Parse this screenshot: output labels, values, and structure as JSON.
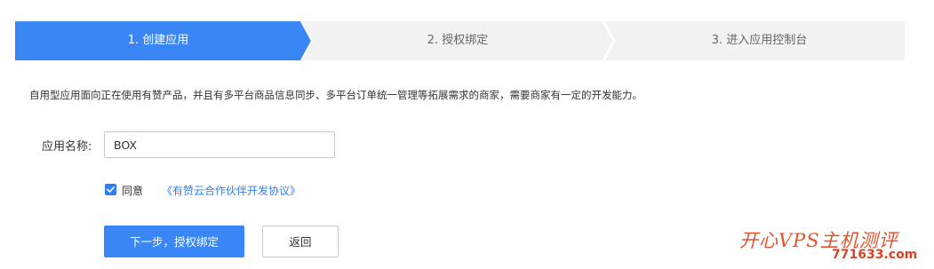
{
  "steps": [
    {
      "label": "1. 创建应用",
      "active": true
    },
    {
      "label": "2. 授权绑定",
      "active": false
    },
    {
      "label": "3. 进入应用控制台",
      "active": false
    }
  ],
  "description": "自用型应用面向正在使用有赞产品，并且有多平台商品信息同步、多平台订单统一管理等拓展需求的商家，需要商家有一定的开发能力。",
  "form": {
    "name_label": "应用名称:",
    "name_value": "BOX",
    "agree_checked": true,
    "agree_label": "同意",
    "agreement_link": "《有赞云合作伙伴开发协议》"
  },
  "buttons": {
    "next_label": "下一步，授权绑定",
    "back_label": "返回"
  },
  "watermark": {
    "title": "开心VPS主机测评",
    "url": "771633.com"
  },
  "colors": {
    "primary": "#3a86f7",
    "step_inactive": "#f2f2f2",
    "link": "#2f7ff5",
    "watermark": "#e3532d"
  }
}
